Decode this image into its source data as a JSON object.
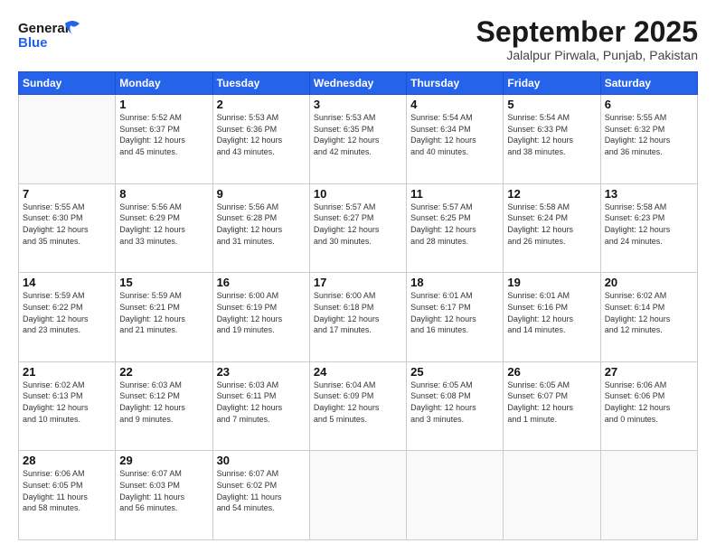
{
  "header": {
    "logo_line1": "General",
    "logo_line2": "Blue",
    "month": "September 2025",
    "location": "Jalalpur Pirwala, Punjab, Pakistan"
  },
  "weekdays": [
    "Sunday",
    "Monday",
    "Tuesday",
    "Wednesday",
    "Thursday",
    "Friday",
    "Saturday"
  ],
  "weeks": [
    [
      {
        "day": "",
        "info": ""
      },
      {
        "day": "1",
        "info": "Sunrise: 5:52 AM\nSunset: 6:37 PM\nDaylight: 12 hours\nand 45 minutes."
      },
      {
        "day": "2",
        "info": "Sunrise: 5:53 AM\nSunset: 6:36 PM\nDaylight: 12 hours\nand 43 minutes."
      },
      {
        "day": "3",
        "info": "Sunrise: 5:53 AM\nSunset: 6:35 PM\nDaylight: 12 hours\nand 42 minutes."
      },
      {
        "day": "4",
        "info": "Sunrise: 5:54 AM\nSunset: 6:34 PM\nDaylight: 12 hours\nand 40 minutes."
      },
      {
        "day": "5",
        "info": "Sunrise: 5:54 AM\nSunset: 6:33 PM\nDaylight: 12 hours\nand 38 minutes."
      },
      {
        "day": "6",
        "info": "Sunrise: 5:55 AM\nSunset: 6:32 PM\nDaylight: 12 hours\nand 36 minutes."
      }
    ],
    [
      {
        "day": "7",
        "info": "Sunrise: 5:55 AM\nSunset: 6:30 PM\nDaylight: 12 hours\nand 35 minutes."
      },
      {
        "day": "8",
        "info": "Sunrise: 5:56 AM\nSunset: 6:29 PM\nDaylight: 12 hours\nand 33 minutes."
      },
      {
        "day": "9",
        "info": "Sunrise: 5:56 AM\nSunset: 6:28 PM\nDaylight: 12 hours\nand 31 minutes."
      },
      {
        "day": "10",
        "info": "Sunrise: 5:57 AM\nSunset: 6:27 PM\nDaylight: 12 hours\nand 30 minutes."
      },
      {
        "day": "11",
        "info": "Sunrise: 5:57 AM\nSunset: 6:25 PM\nDaylight: 12 hours\nand 28 minutes."
      },
      {
        "day": "12",
        "info": "Sunrise: 5:58 AM\nSunset: 6:24 PM\nDaylight: 12 hours\nand 26 minutes."
      },
      {
        "day": "13",
        "info": "Sunrise: 5:58 AM\nSunset: 6:23 PM\nDaylight: 12 hours\nand 24 minutes."
      }
    ],
    [
      {
        "day": "14",
        "info": "Sunrise: 5:59 AM\nSunset: 6:22 PM\nDaylight: 12 hours\nand 23 minutes."
      },
      {
        "day": "15",
        "info": "Sunrise: 5:59 AM\nSunset: 6:21 PM\nDaylight: 12 hours\nand 21 minutes."
      },
      {
        "day": "16",
        "info": "Sunrise: 6:00 AM\nSunset: 6:19 PM\nDaylight: 12 hours\nand 19 minutes."
      },
      {
        "day": "17",
        "info": "Sunrise: 6:00 AM\nSunset: 6:18 PM\nDaylight: 12 hours\nand 17 minutes."
      },
      {
        "day": "18",
        "info": "Sunrise: 6:01 AM\nSunset: 6:17 PM\nDaylight: 12 hours\nand 16 minutes."
      },
      {
        "day": "19",
        "info": "Sunrise: 6:01 AM\nSunset: 6:16 PM\nDaylight: 12 hours\nand 14 minutes."
      },
      {
        "day": "20",
        "info": "Sunrise: 6:02 AM\nSunset: 6:14 PM\nDaylight: 12 hours\nand 12 minutes."
      }
    ],
    [
      {
        "day": "21",
        "info": "Sunrise: 6:02 AM\nSunset: 6:13 PM\nDaylight: 12 hours\nand 10 minutes."
      },
      {
        "day": "22",
        "info": "Sunrise: 6:03 AM\nSunset: 6:12 PM\nDaylight: 12 hours\nand 9 minutes."
      },
      {
        "day": "23",
        "info": "Sunrise: 6:03 AM\nSunset: 6:11 PM\nDaylight: 12 hours\nand 7 minutes."
      },
      {
        "day": "24",
        "info": "Sunrise: 6:04 AM\nSunset: 6:09 PM\nDaylight: 12 hours\nand 5 minutes."
      },
      {
        "day": "25",
        "info": "Sunrise: 6:05 AM\nSunset: 6:08 PM\nDaylight: 12 hours\nand 3 minutes."
      },
      {
        "day": "26",
        "info": "Sunrise: 6:05 AM\nSunset: 6:07 PM\nDaylight: 12 hours\nand 1 minute."
      },
      {
        "day": "27",
        "info": "Sunrise: 6:06 AM\nSunset: 6:06 PM\nDaylight: 12 hours\nand 0 minutes."
      }
    ],
    [
      {
        "day": "28",
        "info": "Sunrise: 6:06 AM\nSunset: 6:05 PM\nDaylight: 11 hours\nand 58 minutes."
      },
      {
        "day": "29",
        "info": "Sunrise: 6:07 AM\nSunset: 6:03 PM\nDaylight: 11 hours\nand 56 minutes."
      },
      {
        "day": "30",
        "info": "Sunrise: 6:07 AM\nSunset: 6:02 PM\nDaylight: 11 hours\nand 54 minutes."
      },
      {
        "day": "",
        "info": ""
      },
      {
        "day": "",
        "info": ""
      },
      {
        "day": "",
        "info": ""
      },
      {
        "day": "",
        "info": ""
      }
    ]
  ]
}
